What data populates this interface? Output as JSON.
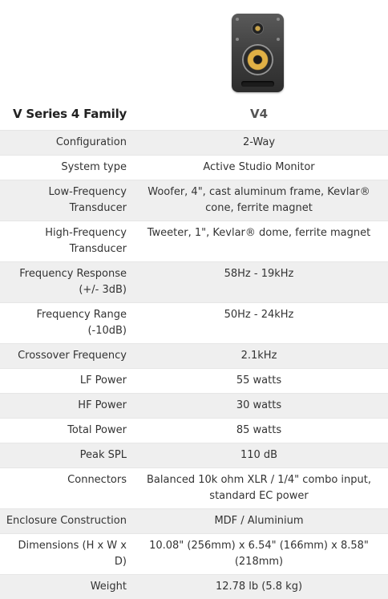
{
  "header": {
    "family_title": "V Series 4 Family",
    "model_name": "V4",
    "product_image_icon": "studio-monitor-speaker-icon"
  },
  "specs": [
    {
      "label": "Configuration",
      "value": "2-Way"
    },
    {
      "label": "System type",
      "value": "Active Studio Monitor"
    },
    {
      "label": "Low-Frequency Transducer",
      "value": "Woofer, 4\", cast aluminum frame, Kevlar® cone, ferrite magnet"
    },
    {
      "label": "High-Frequency Transducer",
      "value": "Tweeter, 1\", Kevlar® dome, ferrite magnet"
    },
    {
      "label": "Frequency Response (+/- 3dB)",
      "value": "58Hz - 19kHz"
    },
    {
      "label": "Frequency Range (-10dB)",
      "value": "50Hz - 24kHz"
    },
    {
      "label": "Crossover Frequency",
      "value": "2.1kHz"
    },
    {
      "label": "LF Power",
      "value": "55 watts"
    },
    {
      "label": "HF Power",
      "value": "30 watts"
    },
    {
      "label": "Total Power",
      "value": "85 watts"
    },
    {
      "label": "Peak SPL",
      "value": "110 dB"
    },
    {
      "label": "Connectors",
      "value": "Balanced 10k ohm XLR / 1/4\" combo input, standard EC power"
    },
    {
      "label": "Enclosure Construction",
      "value": "MDF / Aluminium"
    },
    {
      "label": "Dimensions (H x W x D)",
      "value": "10.08\" (256mm) x 6.54\" (166mm) x 8.58\" (218mm)"
    },
    {
      "label": "Weight",
      "value": "12.78 lb (5.8 kg)"
    }
  ],
  "colors": {
    "row_shade": "#efefef",
    "text": "#333333"
  }
}
